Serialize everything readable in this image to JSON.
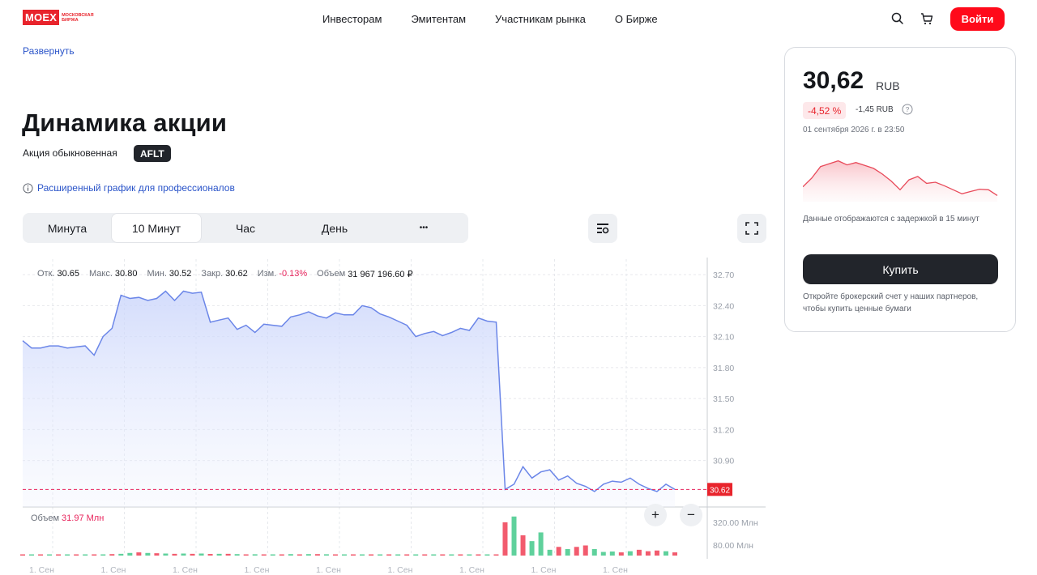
{
  "header": {
    "logo_text": "MOEX",
    "logo_sub": "МОСКОВСКАЯ БИРЖА",
    "nav": [
      "Инвесторам",
      "Эмитентам",
      "Участникам рынка",
      "О Бирже"
    ],
    "login_label": "Войти"
  },
  "expand_label": "Развернуть",
  "page_title": "Динамика акции",
  "subtitle": "Акция обыкновенная",
  "ticker": "AFLT",
  "pro_link": "Расширенный график для профессионалов",
  "tabs": [
    "Минута",
    "10 Минут",
    "Час",
    "День",
    "•••"
  ],
  "active_tab": "10 Минут",
  "ohlc": {
    "open_label": "Отк.",
    "open": "30.65",
    "high_label": "Макс.",
    "high": "30.80",
    "low_label": "Мин.",
    "low": "30.52",
    "close_label": "Закр.",
    "close": "30.62",
    "change_label": "Изм.",
    "change": "-0.13%",
    "volume_label": "Объем",
    "volume": "31 967 196.60 ₽"
  },
  "volume_panel": {
    "label": "Объем",
    "value": "31.97 Млн"
  },
  "chart_data": {
    "type": "area",
    "y_ticks": [
      "32.70",
      "32.40",
      "32.10",
      "31.80",
      "31.50",
      "31.20",
      "30.90"
    ],
    "ylim": [
      30.45,
      32.85
    ],
    "current_price_label": "30.62",
    "x_tick_labels": [
      "1. Сен",
      "1. Сен",
      "1. Сен",
      "1. Сен",
      "1. Сен",
      "1. Сен",
      "1. Сен",
      "1. Сен",
      "1. Сен"
    ],
    "series": [
      {
        "values": [
          32.06,
          31.99,
          31.99,
          32.01,
          32.01,
          31.99,
          32.0,
          32.01,
          31.92,
          32.1,
          32.18,
          32.5,
          32.47,
          32.48,
          32.45,
          32.47,
          32.54,
          32.45,
          32.54,
          32.52,
          32.53,
          32.24,
          32.26,
          32.28,
          32.17,
          32.21,
          32.14,
          32.22,
          32.21,
          32.2,
          32.29,
          32.31,
          32.34,
          32.3,
          32.28,
          32.33,
          32.31,
          32.31,
          32.4,
          32.38,
          32.32,
          32.29,
          32.25,
          32.21,
          32.1,
          32.13,
          32.15,
          32.11,
          32.14,
          32.18,
          32.16,
          32.28,
          32.25,
          32.24,
          30.62,
          30.67,
          30.84,
          30.73,
          30.79,
          30.81,
          30.71,
          30.75,
          30.68,
          30.65,
          30.6,
          30.67,
          30.7,
          30.69,
          30.73,
          30.67,
          30.63,
          30.6,
          30.67,
          30.62
        ]
      }
    ],
    "volume_y_ticks": [
      "320.00 Млн",
      "80.00 Млн"
    ],
    "volume_bars_mln": [
      5,
      5,
      5,
      5,
      5,
      5,
      5,
      5,
      5,
      8,
      10,
      12,
      18,
      22,
      18,
      16,
      14,
      12,
      14,
      12,
      14,
      11,
      12,
      12,
      10,
      8,
      9,
      8,
      8,
      8,
      10,
      8,
      10,
      10,
      9,
      8,
      7,
      7,
      8,
      7,
      5,
      6,
      5,
      7,
      5,
      5,
      6,
      7,
      6,
      8,
      5,
      5,
      6,
      4,
      230,
      270,
      140,
      100,
      160,
      40,
      60,
      45,
      60,
      70,
      45,
      25,
      28,
      22,
      30,
      40,
      30,
      35,
      30,
      22
    ],
    "volume_bar_colors": [
      "r",
      "g",
      "r",
      "g",
      "r",
      "g",
      "r",
      "g",
      "r",
      "g",
      "r",
      "g",
      "g",
      "r",
      "g",
      "r",
      "g",
      "r",
      "g",
      "r",
      "g",
      "r",
      "g",
      "r",
      "g",
      "r",
      "g",
      "r",
      "g",
      "r",
      "g",
      "r",
      "g",
      "r",
      "g",
      "r",
      "g",
      "r",
      "g",
      "r",
      "g",
      "r",
      "g",
      "r",
      "g",
      "r",
      "g",
      "r",
      "g",
      "r",
      "g",
      "r",
      "g",
      "r",
      "r",
      "g",
      "r",
      "g",
      "g",
      "g",
      "r",
      "g",
      "r",
      "r",
      "g",
      "g",
      "g",
      "r",
      "g",
      "r",
      "r",
      "r",
      "g",
      "r"
    ]
  },
  "zoom": {
    "in": "+",
    "out": "−"
  },
  "card": {
    "price": "30,62",
    "currency": "RUB",
    "change_pct": "-4,52 %",
    "change_abs": "-1,45 RUB",
    "date": "01 сентября 2026 г. в 23:50",
    "mini_chart_values": [
      31.6,
      31.75,
      31.95,
      32.0,
      32.05,
      31.98,
      32.02,
      31.97,
      31.92,
      31.82,
      31.7,
      31.55,
      31.72,
      31.78,
      31.66,
      31.68,
      31.62,
      31.55,
      31.48,
      31.52,
      31.56,
      31.55,
      31.45
    ],
    "delay_note": "Данные отображаются с задержкой в 15 минут",
    "buy_label": "Купить",
    "broker_note": "Откройте брокерский счет у наших партнеров, чтобы купить ценные бумаги"
  },
  "colors": {
    "accent_red": "#ff0a1a",
    "line_blue": "#6b86e8",
    "vol_green": "#5fd19c",
    "vol_red": "#f25b6e",
    "price_label_bg": "#e8242c"
  }
}
